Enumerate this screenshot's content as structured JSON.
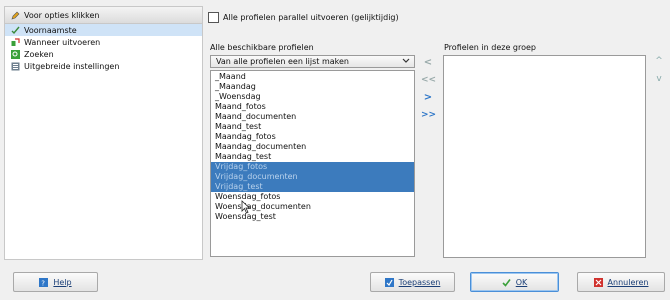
{
  "left": {
    "header": "Voor opties klikken",
    "items": [
      {
        "label": "Voornaamste",
        "icon": "check-pen-icon",
        "selected": true
      },
      {
        "label": "Wanneer uitvoeren",
        "icon": "schedule-icon",
        "selected": false
      },
      {
        "label": "Zoeken",
        "icon": "search-icon",
        "selected": false
      },
      {
        "label": "Uitgebreide instellingen",
        "icon": "settings-icon",
        "selected": false
      }
    ]
  },
  "parallel_checkbox": {
    "label": "Alle profielen parallel uitvoeren (gelijktijdig)",
    "checked": false
  },
  "available": {
    "title": "Alle beschikbare profielen",
    "dropdown_value": "Van alle profielen een lijst maken",
    "items": [
      "_Maand",
      "_Maandag",
      "_Woensdag",
      "Maand_fotos",
      "Maand_documenten",
      "Maand_test",
      "Maandag_fotos",
      "Maandag_documenten",
      "Maandag_test",
      "Vrijdag_fotos",
      "Vrijdag_documenten",
      "Vrijdag_test",
      "Woensdag_fotos",
      "Woensdag_documenten",
      "Woensdag_test"
    ],
    "selected_items": [
      "Vrijdag_fotos",
      "Vrijdag_documenten",
      "Vrijdag_test"
    ]
  },
  "transfer_buttons": [
    "<",
    "<<",
    ">",
    ">>"
  ],
  "group": {
    "title": "Profielen in deze groep",
    "items": []
  },
  "order_buttons": [
    "^",
    "v"
  ],
  "buttons": {
    "help": "Help",
    "apply": "Toepassen",
    "ok": "OK",
    "cancel": "Annuleren"
  },
  "colors": {
    "selection": "#3c7bbd",
    "accent": "#2f77c8",
    "cancel_icon": "#d0312d",
    "ok_icon": "#3aa03a"
  }
}
